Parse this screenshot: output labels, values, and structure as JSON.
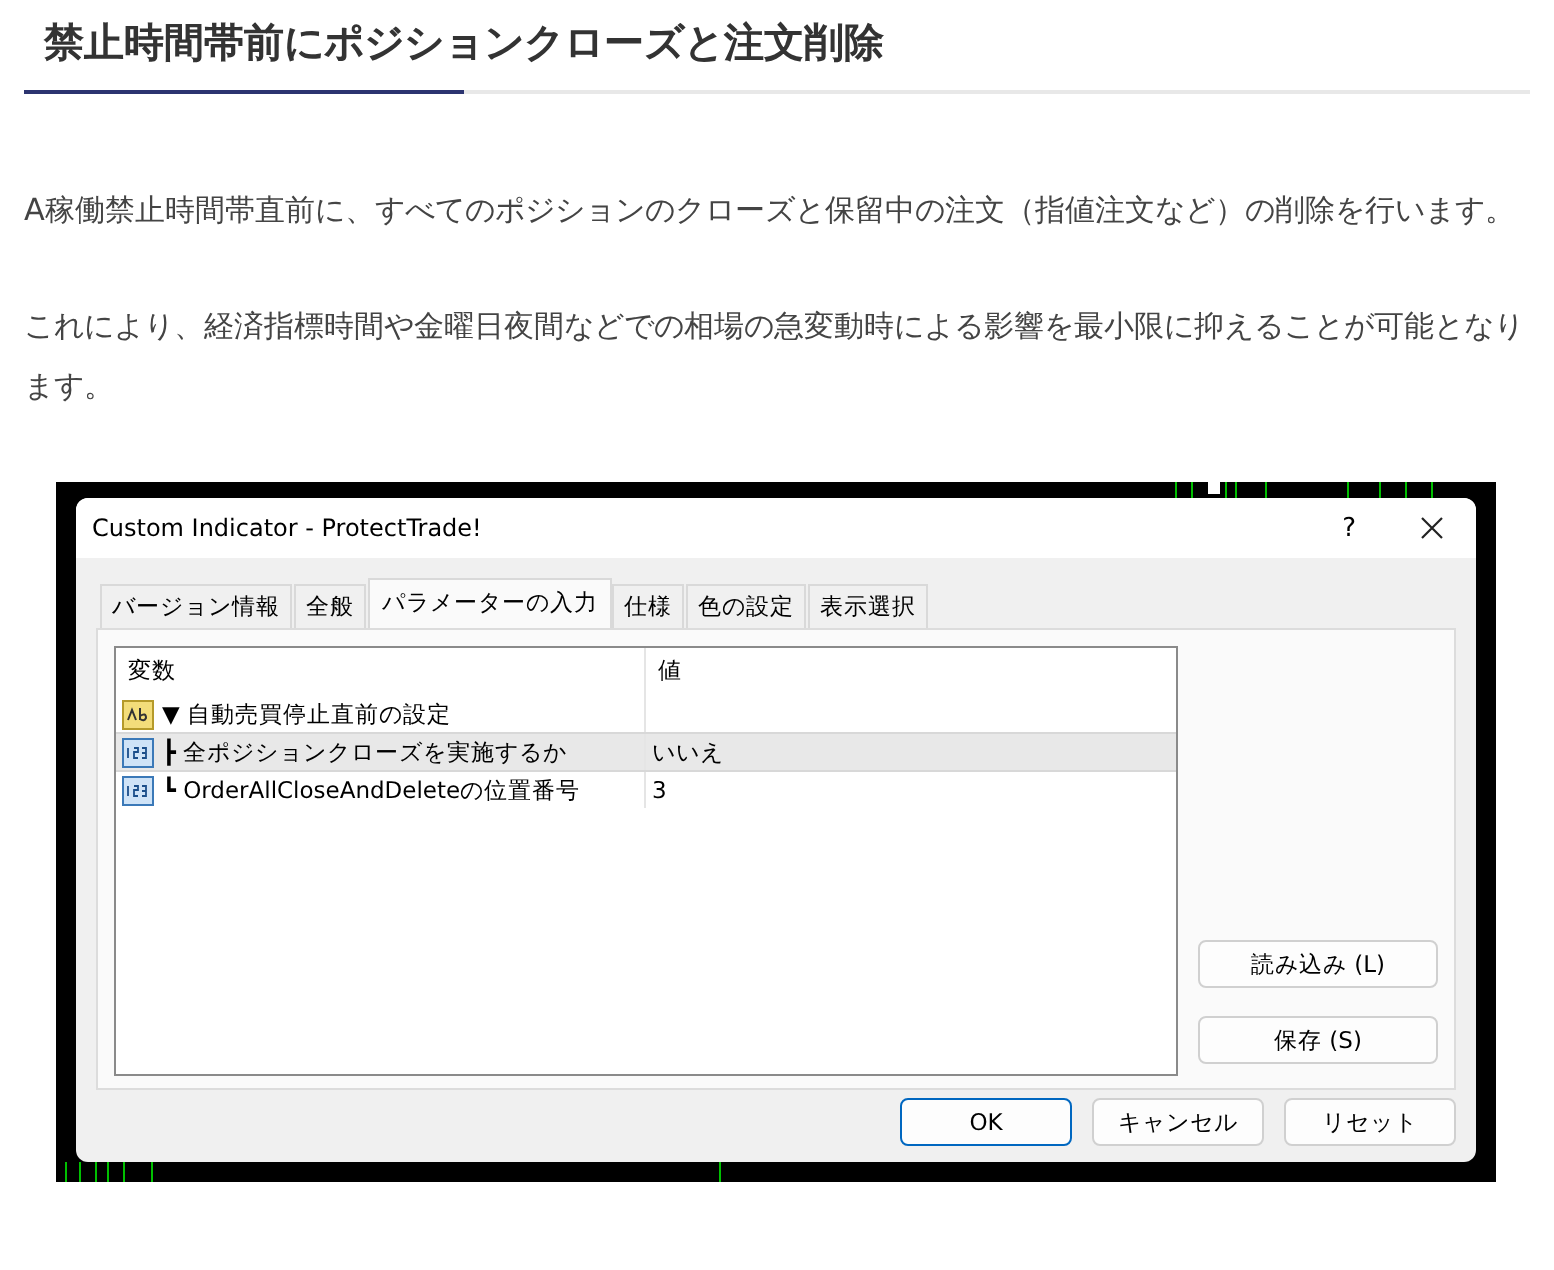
{
  "heading": "禁止時間帯前にポジションクローズと注文削除",
  "paragraphs": [
    "A稼働禁止時間帯直前に、すべてのポジションのクローズと保留中の注文（指値注文など）の削除を行います。",
    "これにより、経済指標時間や金曜日夜間などでの相場の急変動時による影響を最小限に抑えることが可能となります。"
  ],
  "dialog": {
    "title": "Custom Indicator - ProtectTrade!",
    "help": "?",
    "tabs": [
      {
        "label": "バージョン情報",
        "selected": false
      },
      {
        "label": "全般",
        "selected": false
      },
      {
        "label": "パラメーターの入力",
        "selected": true
      },
      {
        "label": "仕様",
        "selected": false
      },
      {
        "label": "色の設定",
        "selected": false
      },
      {
        "label": "表示選択",
        "selected": false
      }
    ],
    "table": {
      "columns": [
        "変数",
        "値"
      ],
      "rows": [
        {
          "kind": "text",
          "variable": "▼ 自動売買停止直前の設定",
          "selected": false
        },
        {
          "kind": "number",
          "variable": "┣ 全ポジションクローズを実施するか",
          "value": "いいえ",
          "selected": true
        },
        {
          "kind": "number",
          "variable": "┗ OrderAllCloseAndDeleteの位置番号",
          "value": "3",
          "selected": false
        }
      ]
    },
    "side_buttons": [
      "読み込み (L)",
      "保存 (S)"
    ],
    "buttons": [
      {
        "label": "OK",
        "default": true
      },
      {
        "label": "キャンセル",
        "default": false
      },
      {
        "label": "リセット",
        "default": false
      }
    ]
  }
}
